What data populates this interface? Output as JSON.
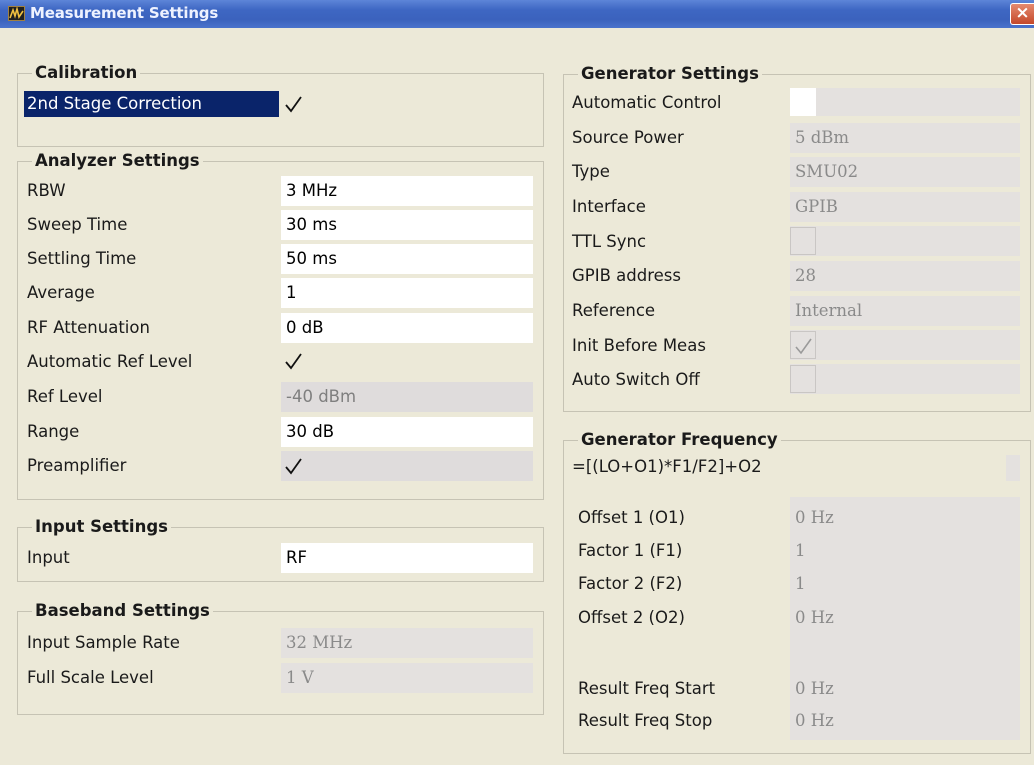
{
  "window": {
    "title": "Measurement Settings",
    "close_icon": "close-icon",
    "close_glyph": "×"
  },
  "calibration": {
    "title": "Calibration",
    "second_stage_label": "2nd Stage Correction",
    "second_stage_checked": true
  },
  "analyzer": {
    "title": "Analyzer Settings",
    "rbw_label": "RBW",
    "rbw_value": "3 MHz",
    "sweep_label": "Sweep Time",
    "sweep_value": "30 ms",
    "settling_label": "Settling Time",
    "settling_value": "50 ms",
    "average_label": "Average",
    "average_value": "1",
    "rf_att_label": "RF Attenuation",
    "rf_att_value": "0 dB",
    "auto_ref_label": "Automatic Ref Level",
    "auto_ref_checked": true,
    "ref_level_label": "Ref Level",
    "ref_level_value": "-40 dBm",
    "range_label": "Range",
    "range_value": "30 dB",
    "preamp_label": "Preamplifier",
    "preamp_checked": true
  },
  "input": {
    "title": "Input Settings",
    "input_label": "Input",
    "input_value": "RF"
  },
  "baseband": {
    "title": "Baseband Settings",
    "sample_rate_label": "Input Sample Rate",
    "sample_rate_value": "32 MHz",
    "full_scale_label": "Full Scale Level",
    "full_scale_value": "1 V"
  },
  "generator": {
    "title": "Generator Settings",
    "auto_control_label": "Automatic Control",
    "auto_control_checked": false,
    "source_power_label": "Source Power",
    "source_power_value": "5 dBm",
    "type_label": "Type",
    "type_value": "SMU02",
    "interface_label": "Interface",
    "interface_value": "GPIB",
    "ttl_label": "TTL Sync",
    "ttl_checked": false,
    "gpib_label": "GPIB address",
    "gpib_value": "28",
    "reference_label": "Reference",
    "reference_value": "Internal",
    "init_label": "Init Before Meas",
    "init_checked": true,
    "auto_switch_label": "Auto Switch Off",
    "auto_switch_checked": false
  },
  "frequency": {
    "title": "Generator Frequency",
    "formula": "=[(LO+O1)*F1/F2]+O2",
    "offset1_label": "Offset 1 (O1)",
    "offset1_value": "0 Hz",
    "factor1_label": "Factor 1 (F1)",
    "factor1_value": "1",
    "factor2_label": "Factor 2 (F2)",
    "factor2_value": "1",
    "offset2_label": "Offset 2 (O2)",
    "offset2_value": "0 Hz",
    "result_start_label": "Result Freq Start",
    "result_start_value": "0 Hz",
    "result_stop_label": "Result Freq Stop",
    "result_stop_value": "0 Hz"
  },
  "colors": {
    "window_bg": "#ece9d8",
    "titlebar": "#3b62bd",
    "selection": "#0a246a",
    "readonly_field": "#e4e1df"
  }
}
